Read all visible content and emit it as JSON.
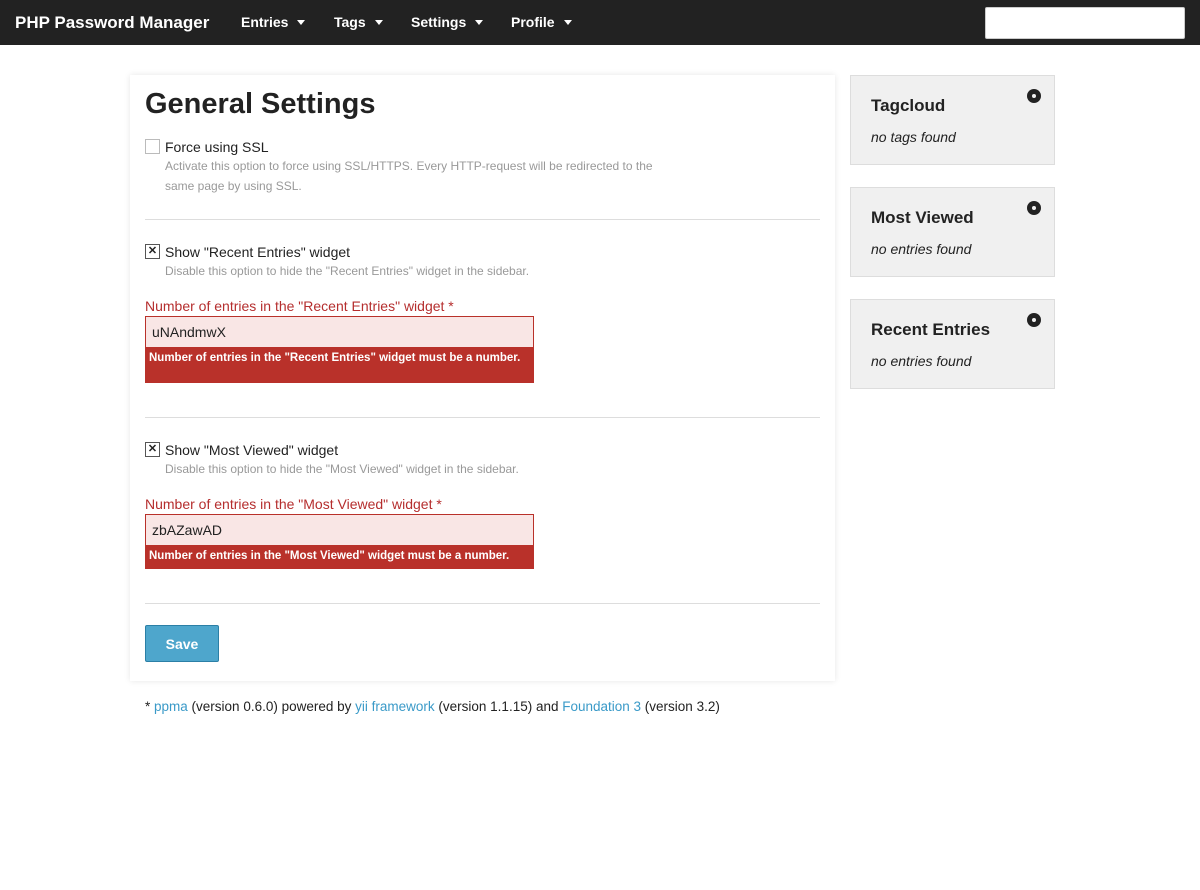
{
  "topbar": {
    "brand": "PHP Password Manager",
    "nav": [
      {
        "label": "Entries"
      },
      {
        "label": "Tags"
      },
      {
        "label": "Settings"
      },
      {
        "label": "Profile"
      }
    ],
    "search": {
      "value": "",
      "placeholder": ""
    }
  },
  "main": {
    "title": "General Settings",
    "force_ssl": {
      "label": "Force using SSL",
      "checked": false,
      "hint": "Activate this option to force using SSL/HTTPS. Every HTTP-request will be redirected to the same page by using SSL."
    },
    "recent": {
      "checkbox_label": "Show \"Recent Entries\" widget",
      "checkbox_mark": "✕",
      "hint": "Disable this option to hide the \"Recent Entries\" widget in the sidebar.",
      "field_label": "Number of entries in the \"Recent Entries\" widget *",
      "value": "uNAndmwX",
      "error": "Number of entries in the \"Recent Entries\" widget must be a number."
    },
    "viewed": {
      "checkbox_label": "Show \"Most Viewed\" widget",
      "checkbox_mark": "✕",
      "hint": "Disable this option to hide the \"Most Viewed\" widget in the sidebar.",
      "field_label": "Number of entries in the \"Most Viewed\" widget *",
      "value": "zbAZawAD",
      "error": "Number of entries in the \"Most Viewed\" widget must be a number."
    },
    "save_label": "Save"
  },
  "footer": {
    "prefix": "* ",
    "ppma": "ppma",
    "t1": " (version 0.6.0) powered by ",
    "yii": "yii framework",
    "t2": " (version 1.1.15) and ",
    "foundation": "Foundation 3",
    "t3": " (version 3.2)"
  },
  "sidebar": {
    "widgets": [
      {
        "title": "Tagcloud",
        "empty": "no tags found",
        "icon": "gear-icon"
      },
      {
        "title": "Most Viewed",
        "empty": "no entries found",
        "icon": "gear-icon"
      },
      {
        "title": "Recent Entries",
        "empty": "no entries found",
        "icon": "gear-icon"
      }
    ]
  },
  "colors": {
    "topbar": "#222222",
    "error": "#b9312a",
    "error_bg": "#f9e6e5",
    "button": "#4ea6cc",
    "link": "#3a9ac8"
  }
}
